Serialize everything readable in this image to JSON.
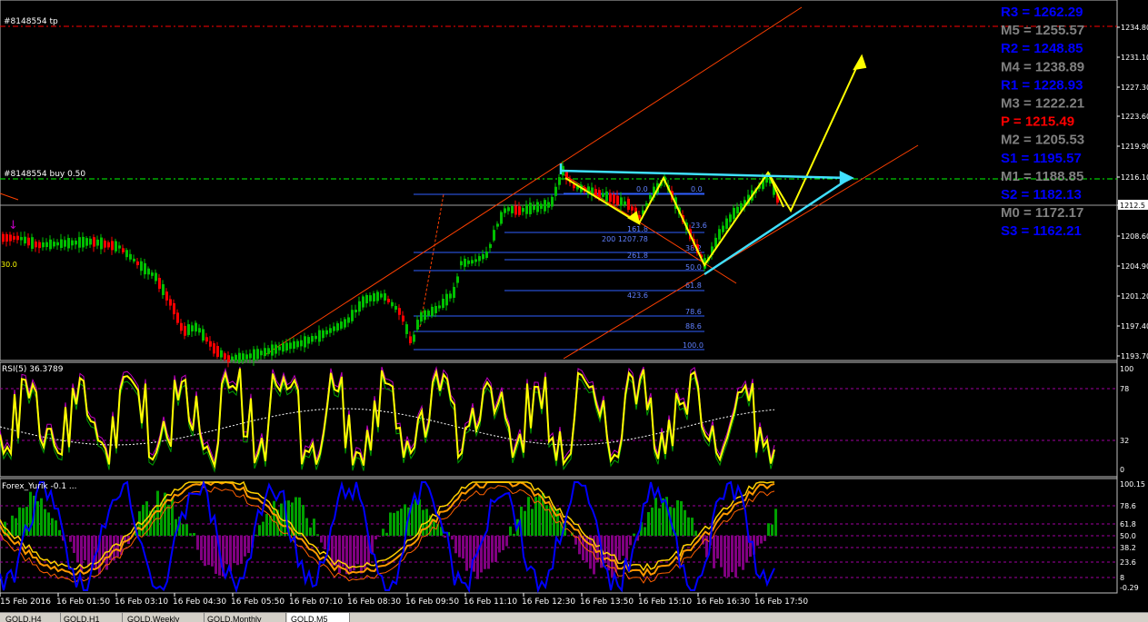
{
  "main": {
    "order_tp_label": "#8148554 tp",
    "order_buy_label": "#8148554 buy 0.50",
    "left_price_tag": "30.0"
  },
  "price_axis": {
    "ticks": [
      "1234.80",
      "1231.10",
      "1227.30",
      "1223.60",
      "1219.90",
      "1216.10",
      "1212.50",
      "1208.60",
      "1204.90",
      "1201.20",
      "1197.40",
      "1193.70"
    ],
    "current_price": "1212.5"
  },
  "pivots": [
    {
      "label": "R3 = 1262.29",
      "color": "#0000ff"
    },
    {
      "label": "M5 = 1255.57",
      "color": "#808080"
    },
    {
      "label": "R2 = 1248.85",
      "color": "#0000ff"
    },
    {
      "label": "M4 = 1238.89",
      "color": "#808080"
    },
    {
      "label": "R1 = 1228.93",
      "color": "#0000ff"
    },
    {
      "label": "M3 = 1222.21",
      "color": "#808080"
    },
    {
      "label": "P  = 1215.49",
      "color": "#ff0000"
    },
    {
      "label": "M2 = 1205.53",
      "color": "#808080"
    },
    {
      "label": "S1 = 1195.57",
      "color": "#0000ff"
    },
    {
      "label": "M1 = 1188.85",
      "color": "#808080"
    },
    {
      "label": "S2 = 1182.13",
      "color": "#0000ff"
    },
    {
      "label": "M0 = 1172.17",
      "color": "#808080"
    },
    {
      "label": "S3 = 1162.21",
      "color": "#0000ff"
    }
  ],
  "fib_labels": [
    "0.0",
    "0.0",
    "23.6",
    "161.8",
    "200 1207.78",
    "261.8",
    "38.2",
    "50.0",
    "423.6",
    "61.8",
    "78.6",
    "88.6",
    "100.0"
  ],
  "rsi": {
    "title": "RSI(5) 36.3789",
    "levels": [
      "100",
      "78",
      "32",
      "0"
    ]
  },
  "indicator2": {
    "title": "Forex_Yurik -0.1 ...",
    "levels": [
      "100.15",
      "78.6",
      "61.8",
      "50.0",
      "38.2",
      "23.6",
      "8",
      "-0.29"
    ]
  },
  "time_axis": [
    "15 Feb 2016",
    "16 Feb 01:50",
    "16 Feb 03:10",
    "16 Feb 04:30",
    "16 Feb 05:50",
    "16 Feb 07:10",
    "16 Feb 08:30",
    "16 Feb 09:50",
    "16 Feb 11:10",
    "16 Feb 12:30",
    "16 Feb 13:50",
    "16 Feb 15:10",
    "16 Feb 16:30",
    "16 Feb 17:50"
  ],
  "tabs": [
    {
      "label": "GOLD,H4",
      "active": false
    },
    {
      "label": "GOLD,H1",
      "active": false
    },
    {
      "label": "GOLD,Weekly",
      "active": false
    },
    {
      "label": "GOLD,Monthly",
      "active": false
    },
    {
      "label": "GOLD,M5",
      "active": true
    }
  ],
  "colors": {
    "bull": "#00c000",
    "bear": "#ff0000",
    "pivot_blue": "#0000ff",
    "pivot_gray": "#808080",
    "pivot_red": "#ff0000",
    "tp_line": "#ff0000",
    "buy_line": "#00ff00",
    "channel": "#ff4000",
    "yellow": "#ffff00",
    "cyan": "#40e0ff",
    "fib": "#3060ff",
    "rsi": "#ffff00",
    "hist_up": "#00a000",
    "hist_down": "#800080",
    "blue_line": "#0000ff",
    "orange": "#ff9900"
  }
}
